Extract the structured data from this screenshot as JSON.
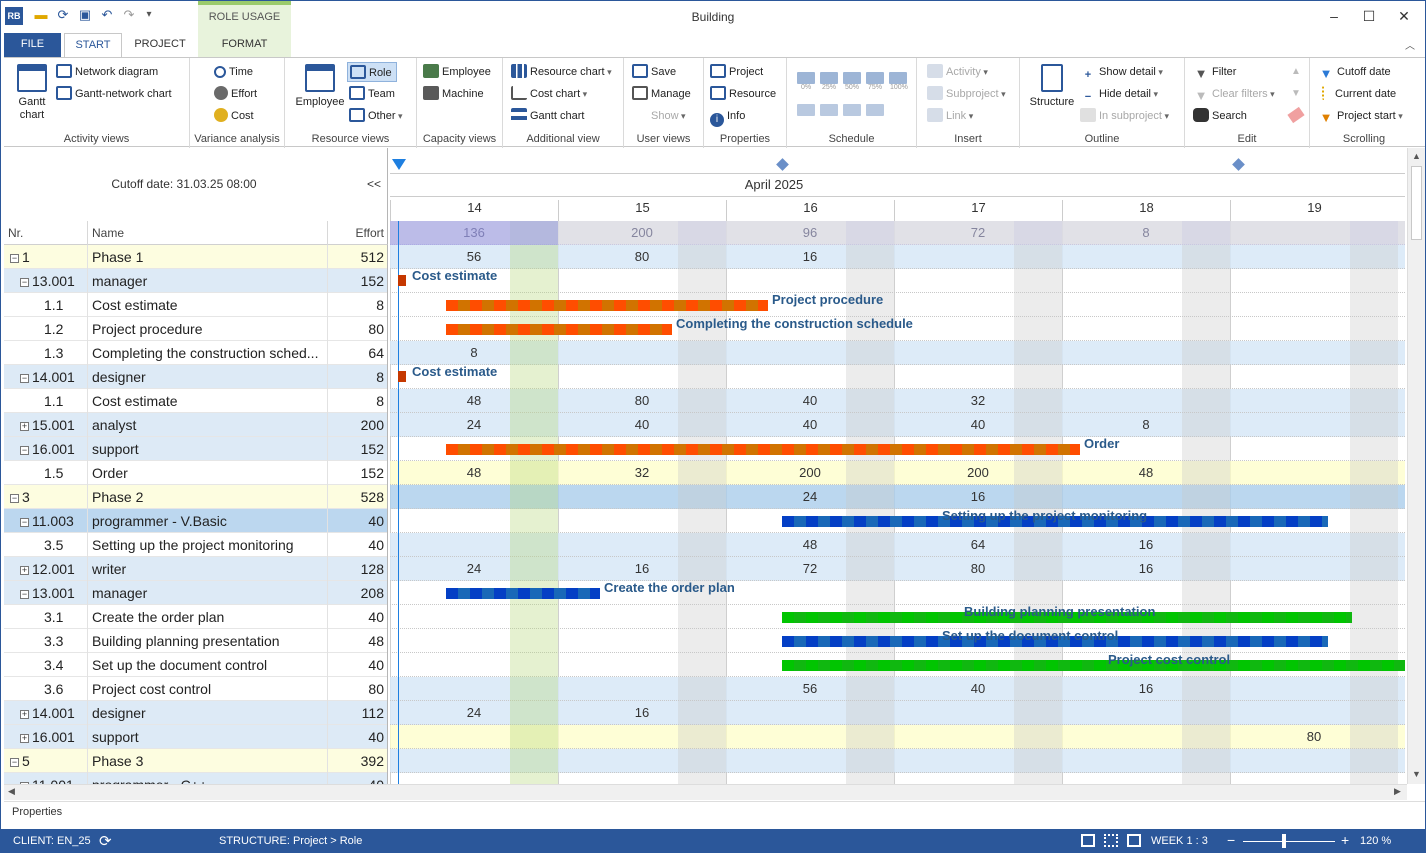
{
  "app": {
    "title": "Building",
    "context_tab": "ROLE USAGE",
    "logo_text": "RB"
  },
  "tabs": [
    "FILE",
    "START",
    "PROJECT",
    "FORMAT"
  ],
  "ribbon": {
    "activity_views": {
      "label": "Activity views",
      "gantt": "Gantt chart",
      "network": "Network diagram",
      "gantt_network": "Gantt-network chart"
    },
    "variance": {
      "label": "Variance analysis",
      "time": "Time",
      "effort": "Effort",
      "cost": "Cost"
    },
    "resource_views": {
      "label": "Resource views",
      "employee": "Employee",
      "role": "Role",
      "team": "Team",
      "other": "Other"
    },
    "capacity_views": {
      "label": "Capacity views",
      "employee": "Employee",
      "machine": "Machine"
    },
    "additional": {
      "label": "Additional view",
      "resource_chart": "Resource chart",
      "cost_chart": "Cost chart",
      "gantt_chart": "Gantt chart"
    },
    "user_views": {
      "label": "User views",
      "save": "Save",
      "manage": "Manage",
      "show": "Show"
    },
    "properties": {
      "label": "Properties",
      "project": "Project",
      "resource": "Resource",
      "info": "Info"
    },
    "schedule": {
      "label": "Schedule",
      "pcts": [
        "0%",
        "25%",
        "50%",
        "75%",
        "100%"
      ]
    },
    "insert": {
      "label": "Insert",
      "activity": "Activity",
      "subproject": "Subproject",
      "link": "Link"
    },
    "outline": {
      "label": "Outline",
      "structure": "Structure",
      "show_detail": "Show detail",
      "hide_detail": "Hide detail",
      "in_subproject": "In subproject"
    },
    "edit": {
      "label": "Edit",
      "filter": "Filter",
      "clear_filters": "Clear filters",
      "search": "Search"
    },
    "scrolling": {
      "label": "Scrolling",
      "cutoff": "Cutoff date",
      "current": "Current date",
      "project_start": "Project start"
    }
  },
  "grid": {
    "cutoff": "Cutoff date: 31.03.25 08:00",
    "collapse": "<<",
    "col_nr": "Nr.",
    "col_name": "Name",
    "col_effort": "Effort"
  },
  "timeline": {
    "month": "April 2025",
    "days": [
      "14",
      "15",
      "16",
      "17",
      "18",
      "19"
    ]
  },
  "rows": [
    {
      "nr": "1",
      "name": "Phase 1",
      "effort": "512",
      "kind": "phase",
      "tg": "−",
      "ind": 0,
      "vals": [
        "136",
        "200",
        "96",
        "72",
        "8",
        ""
      ]
    },
    {
      "nr": "13.001",
      "name": "manager",
      "effort": "152",
      "kind": "res",
      "tg": "−",
      "ind": 1,
      "vals": [
        "56",
        "80",
        "16",
        "",
        "",
        ""
      ]
    },
    {
      "nr": "1.1",
      "name": "Cost estimate",
      "effort": "8",
      "kind": "task",
      "ind": 2,
      "vals": []
    },
    {
      "nr": "1.2",
      "name": "Project procedure",
      "effort": "80",
      "kind": "task",
      "ind": 2,
      "vals": []
    },
    {
      "nr": "1.3",
      "name": "Completing the construction sched...",
      "effort": "64",
      "kind": "task",
      "ind": 2,
      "vals": []
    },
    {
      "nr": "14.001",
      "name": "designer",
      "effort": "8",
      "kind": "res",
      "tg": "−",
      "ind": 1,
      "vals": [
        "8",
        "",
        "",
        "",
        "",
        ""
      ]
    },
    {
      "nr": "1.1",
      "name": "Cost estimate",
      "effort": "8",
      "kind": "task",
      "ind": 2,
      "vals": []
    },
    {
      "nr": "15.001",
      "name": "analyst",
      "effort": "200",
      "kind": "res",
      "tg": "+",
      "ind": 1,
      "vals": [
        "48",
        "80",
        "40",
        "32",
        "",
        ""
      ]
    },
    {
      "nr": "16.001",
      "name": "support",
      "effort": "152",
      "kind": "res",
      "tg": "−",
      "ind": 1,
      "vals": [
        "24",
        "40",
        "40",
        "40",
        "8",
        ""
      ]
    },
    {
      "nr": "1.5",
      "name": "Order",
      "effort": "152",
      "kind": "task",
      "ind": 2,
      "vals": []
    },
    {
      "nr": "3",
      "name": "Phase 2",
      "effort": "528",
      "kind": "phase",
      "tg": "−",
      "ind": 0,
      "vals": [
        "48",
        "32",
        "200",
        "200",
        "48",
        ""
      ]
    },
    {
      "nr": "11.003",
      "name": "programmer - V.Basic",
      "effort": "40",
      "kind": "ressel",
      "tg": "−",
      "ind": 1,
      "vals": [
        "",
        "",
        "24",
        "16",
        "",
        ""
      ]
    },
    {
      "nr": "3.5",
      "name": "Setting up the project monitoring",
      "effort": "40",
      "kind": "task",
      "ind": 2,
      "vals": []
    },
    {
      "nr": "12.001",
      "name": "writer",
      "effort": "128",
      "kind": "res",
      "tg": "+",
      "ind": 1,
      "vals": [
        "",
        "",
        "48",
        "64",
        "16",
        ""
      ]
    },
    {
      "nr": "13.001",
      "name": "manager",
      "effort": "208",
      "kind": "res",
      "tg": "−",
      "ind": 1,
      "vals": [
        "24",
        "16",
        "72",
        "80",
        "16",
        ""
      ]
    },
    {
      "nr": "3.1",
      "name": "Create the order plan",
      "effort": "40",
      "kind": "task",
      "ind": 2,
      "vals": []
    },
    {
      "nr": "3.3",
      "name": "Building planning presentation",
      "effort": "48",
      "kind": "task",
      "ind": 2,
      "vals": []
    },
    {
      "nr": "3.4",
      "name": "Set up the document control",
      "effort": "40",
      "kind": "task",
      "ind": 2,
      "vals": []
    },
    {
      "nr": "3.6",
      "name": "Project cost control",
      "effort": "80",
      "kind": "task",
      "ind": 2,
      "vals": []
    },
    {
      "nr": "14.001",
      "name": "designer",
      "effort": "112",
      "kind": "res",
      "tg": "+",
      "ind": 1,
      "vals": [
        "",
        "",
        "56",
        "40",
        "16",
        ""
      ]
    },
    {
      "nr": "16.001",
      "name": "support",
      "effort": "40",
      "kind": "res",
      "tg": "+",
      "ind": 1,
      "vals": [
        "24",
        "16",
        "",
        "",
        "",
        ""
      ]
    },
    {
      "nr": "5",
      "name": "Phase 3",
      "effort": "392",
      "kind": "phase",
      "tg": "−",
      "ind": 0,
      "vals": [
        "",
        "",
        "",
        "",
        "",
        "80"
      ]
    },
    {
      "nr": "11.001",
      "name": "programmer - C++",
      "effort": "40",
      "kind": "res",
      "tg": "−",
      "ind": 1,
      "vals": []
    }
  ],
  "bars": [
    {
      "row": 2,
      "label": "Cost estimate",
      "color": "#e07800"
    },
    {
      "row": 3,
      "label": "Project procedure",
      "color": "#ff8c00"
    },
    {
      "row": 4,
      "label": "Completing the construction schedule",
      "color": "#ff8c00"
    },
    {
      "row": 6,
      "label": "Cost estimate",
      "color": "#e07800"
    },
    {
      "row": 9,
      "label": "Order",
      "color": "#ff8c00"
    },
    {
      "row": 12,
      "label": "Setting up the project monitoring",
      "color": "#1e7fe0"
    },
    {
      "row": 15,
      "label": "Create the order plan",
      "color": "#1e7fe0"
    },
    {
      "row": 16,
      "label": "Building planning presentation",
      "color": "#13e013"
    },
    {
      "row": 17,
      "label": "Set up the document control",
      "color": "#1e7fe0"
    },
    {
      "row": 18,
      "label": "Project cost control",
      "color": "#13e013"
    }
  ],
  "properties_tab": "Properties",
  "status": {
    "client": "CLIENT: EN_25",
    "structure": "STRUCTURE: Project > Role",
    "week": "WEEK 1 : 3",
    "zoom": "120 %"
  }
}
